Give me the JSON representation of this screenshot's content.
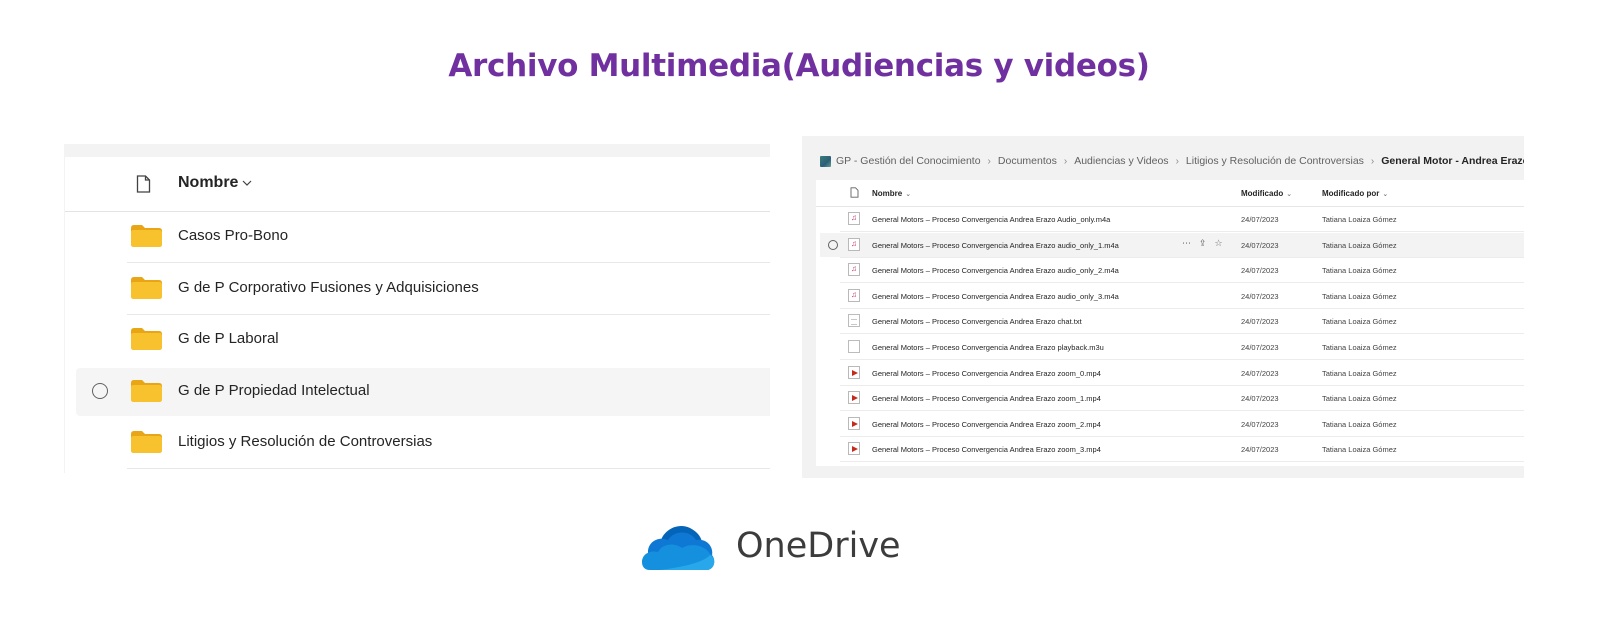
{
  "page": {
    "title": "Archivo Multimedia(Audiencias y videos)"
  },
  "left_panel": {
    "column_header": "Nombre",
    "folders": [
      {
        "label": "Casos Pro-Bono",
        "selected": false
      },
      {
        "label": "G de P Corporativo Fusiones y Adquisiciones",
        "selected": false
      },
      {
        "label": "G de P Laboral",
        "selected": false
      },
      {
        "label": "G de P Propiedad Intelectual",
        "selected": true
      },
      {
        "label": "Litigios y Resolución de Controversias",
        "selected": false
      }
    ]
  },
  "right_panel": {
    "breadcrumb": [
      "GP - Gestión del Conocimiento",
      "Documentos",
      "Audiencias y Videos",
      "Litigios y Resolución de Controversias",
      "General Motor - Andrea Erazo - Audiencias"
    ],
    "columns": {
      "name": "Nombre",
      "modified": "Modificado",
      "modified_by": "Modificado por"
    },
    "files": [
      {
        "name": "General Motors – Proceso Convergencia Andrea Erazo Audio_only.m4a",
        "modified": "24/07/2023",
        "modified_by": "Tatiana Loaiza Gómez",
        "icon": "audio-file-icon"
      },
      {
        "name": "General Motors – Proceso Convergencia Andrea Erazo audio_only_1.m4a",
        "modified": "24/07/2023",
        "modified_by": "Tatiana Loaiza Gómez",
        "icon": "audio-file-icon"
      },
      {
        "name": "General Motors – Proceso Convergencia Andrea Erazo audio_only_2.m4a",
        "modified": "24/07/2023",
        "modified_by": "Tatiana Loaiza Gómez",
        "icon": "audio-file-icon"
      },
      {
        "name": "General Motors – Proceso Convergencia Andrea Erazo audio_only_3.m4a",
        "modified": "24/07/2023",
        "modified_by": "Tatiana Loaiza Gómez",
        "icon": "audio-file-icon"
      },
      {
        "name": "General Motors – Proceso Convergencia Andrea Erazo chat.txt",
        "modified": "24/07/2023",
        "modified_by": "Tatiana Loaiza Gómez",
        "icon": "text-file-icon"
      },
      {
        "name": "General Motors – Proceso Convergencia Andrea Erazo playback.m3u",
        "modified": "24/07/2023",
        "modified_by": "Tatiana Loaiza Gómez",
        "icon": "generic-file-icon"
      },
      {
        "name": "General Motors – Proceso Convergencia Andrea Erazo zoom_0.mp4",
        "modified": "24/07/2023",
        "modified_by": "Tatiana Loaiza Gómez",
        "icon": "video-file-icon"
      },
      {
        "name": "General Motors – Proceso Convergencia Andrea Erazo zoom_1.mp4",
        "modified": "24/07/2023",
        "modified_by": "Tatiana Loaiza Gómez",
        "icon": "video-file-icon"
      },
      {
        "name": "General Motors – Proceso Convergencia Andrea Erazo zoom_2.mp4",
        "modified": "24/07/2023",
        "modified_by": "Tatiana Loaiza Gómez",
        "icon": "video-file-icon"
      },
      {
        "name": "General Motors – Proceso Convergencia Andrea Erazo zoom_3.mp4",
        "modified": "24/07/2023",
        "modified_by": "Tatiana Loaiza Gómez",
        "icon": "video-file-icon"
      }
    ],
    "selected_index": 1
  },
  "brand": {
    "name": "OneDrive"
  },
  "colors": {
    "title": "#7030a0",
    "folder": "#f8c22f",
    "cloud_dark": "#0364b8",
    "cloud_mid": "#0f78d4",
    "cloud_light": "#28a8ea"
  }
}
